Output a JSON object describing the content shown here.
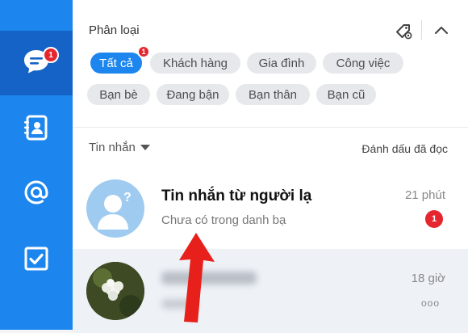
{
  "sidebar": {
    "items": [
      {
        "name": "messages",
        "icon": "chat-bubble-icon",
        "badge": "1",
        "active": true
      },
      {
        "name": "contacts",
        "icon": "contact-book-icon"
      },
      {
        "name": "mentions",
        "icon": "at-sign-icon"
      },
      {
        "name": "todo",
        "icon": "checkbox-icon"
      }
    ]
  },
  "category": {
    "title": "Phân loại",
    "chips": [
      {
        "label": "Tất cả",
        "badge": "1",
        "active": true
      },
      {
        "label": "Khách hàng"
      },
      {
        "label": "Gia đình"
      },
      {
        "label": "Công việc"
      },
      {
        "label": "Bạn bè"
      },
      {
        "label": "Đang bận"
      },
      {
        "label": "Bạn thân"
      },
      {
        "label": "Bạn cũ"
      }
    ]
  },
  "messages_header": {
    "label": "Tin nhắn",
    "mark_read": "Đánh dấu đã đọc"
  },
  "conversations": [
    {
      "name": "Tin nhắn từ người lạ",
      "subtitle": "Chưa có trong danh bạ",
      "time": "21 phút",
      "unread": "1"
    },
    {
      "time": "18 giờ",
      "more": "ooo"
    }
  ],
  "colors": {
    "accent": "#1c86ee",
    "badge": "#e5262f",
    "arrow": "#e8201c"
  }
}
